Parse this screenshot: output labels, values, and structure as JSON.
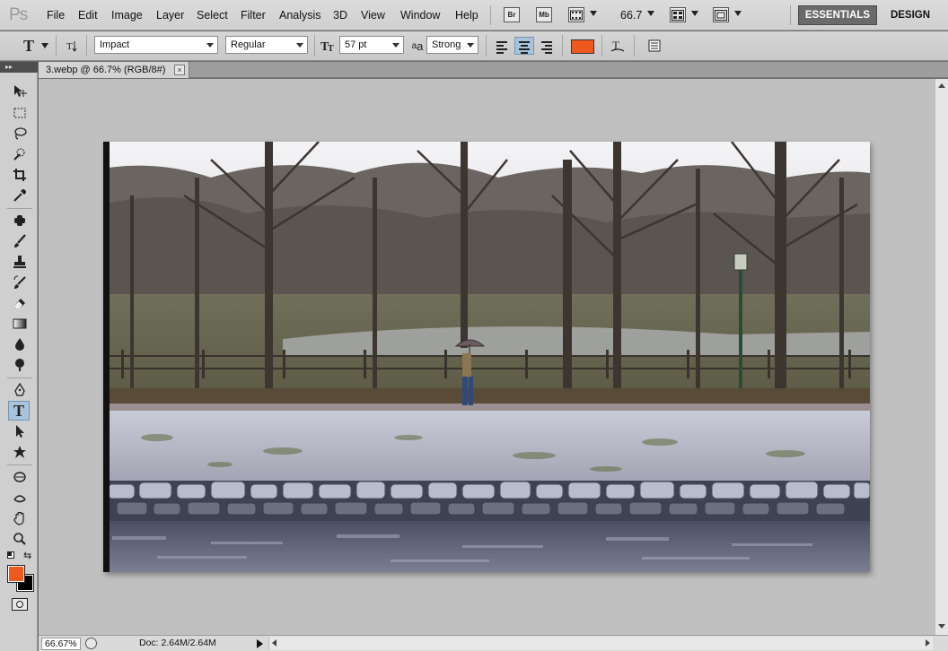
{
  "app": {
    "logo": "Ps",
    "menu": [
      "File",
      "Edit",
      "Image",
      "Layer",
      "Select",
      "Filter",
      "Analysis",
      "3D",
      "View",
      "Window",
      "Help"
    ],
    "bridge_label": "Br",
    "minibridge_label": "Mb",
    "zoom": "66.7",
    "workspaces": {
      "active": "ESSENTIALS",
      "other": "DESIGN"
    }
  },
  "options": {
    "font_family": "Impact",
    "font_style": "Regular",
    "font_size": "57 pt",
    "antialias": "Strong",
    "antialias_icon": "a",
    "text_color": "#f0591e"
  },
  "document": {
    "tab_title": "3.webp @ 66.7% (RGB/8#)",
    "tab_close": "×"
  },
  "colors": {
    "foreground": "#f0591e",
    "background": "#000000",
    "accent_active": "#a8c4dc"
  },
  "tools": [
    "move-icon",
    "marquee-icon",
    "lasso-icon",
    "quick-select-icon",
    "crop-icon",
    "eyedropper-icon",
    "spot-heal-icon",
    "brush-icon",
    "stamp-icon",
    "history-brush-icon",
    "eraser-icon",
    "gradient-icon",
    "blur-icon",
    "dodge-icon",
    "pen-icon",
    "type-icon",
    "path-select-icon",
    "shape-icon",
    "3d-rotate-icon",
    "3d-orbit-icon",
    "hand-icon",
    "zoom-icon"
  ],
  "status": {
    "zoom": "66.67%",
    "doc_info": "Doc: 2.64M/2.64M"
  }
}
